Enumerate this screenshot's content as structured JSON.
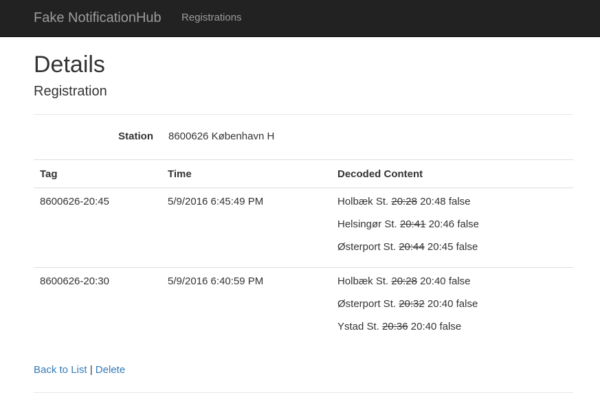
{
  "navbar": {
    "brand": "Fake NotificationHub",
    "links": [
      "Registrations"
    ]
  },
  "page": {
    "title": "Details",
    "subtitle": "Registration"
  },
  "station": {
    "label": "Station",
    "value": "8600626 København H"
  },
  "table": {
    "headers": [
      "Tag",
      "Time",
      "Decoded Content"
    ],
    "rows": [
      {
        "tag": "8600626-20:45",
        "time": "5/9/2016 6:45:49 PM",
        "entries": [
          {
            "station": "Holbæk St.",
            "old": "20:28",
            "new": "20:48",
            "flag": "false"
          },
          {
            "station": "Helsingør St.",
            "old": "20:41",
            "new": "20:46",
            "flag": "false"
          },
          {
            "station": "Østerport St.",
            "old": "20:44",
            "new": "20:45",
            "flag": "false"
          }
        ]
      },
      {
        "tag": "8600626-20:30",
        "time": "5/9/2016 6:40:59 PM",
        "entries": [
          {
            "station": "Holbæk St.",
            "old": "20:28",
            "new": "20:40",
            "flag": "false"
          },
          {
            "station": "Østerport St.",
            "old": "20:32",
            "new": "20:40",
            "flag": "false"
          },
          {
            "station": "Ystad St.",
            "old": "20:36",
            "new": "20:40",
            "flag": "false"
          }
        ]
      }
    ]
  },
  "actions": {
    "back_label": "Back to List",
    "separator": "|",
    "delete_label": "Delete"
  },
  "colors": {
    "navbar_bg": "#222222",
    "link": "#337ab7"
  }
}
